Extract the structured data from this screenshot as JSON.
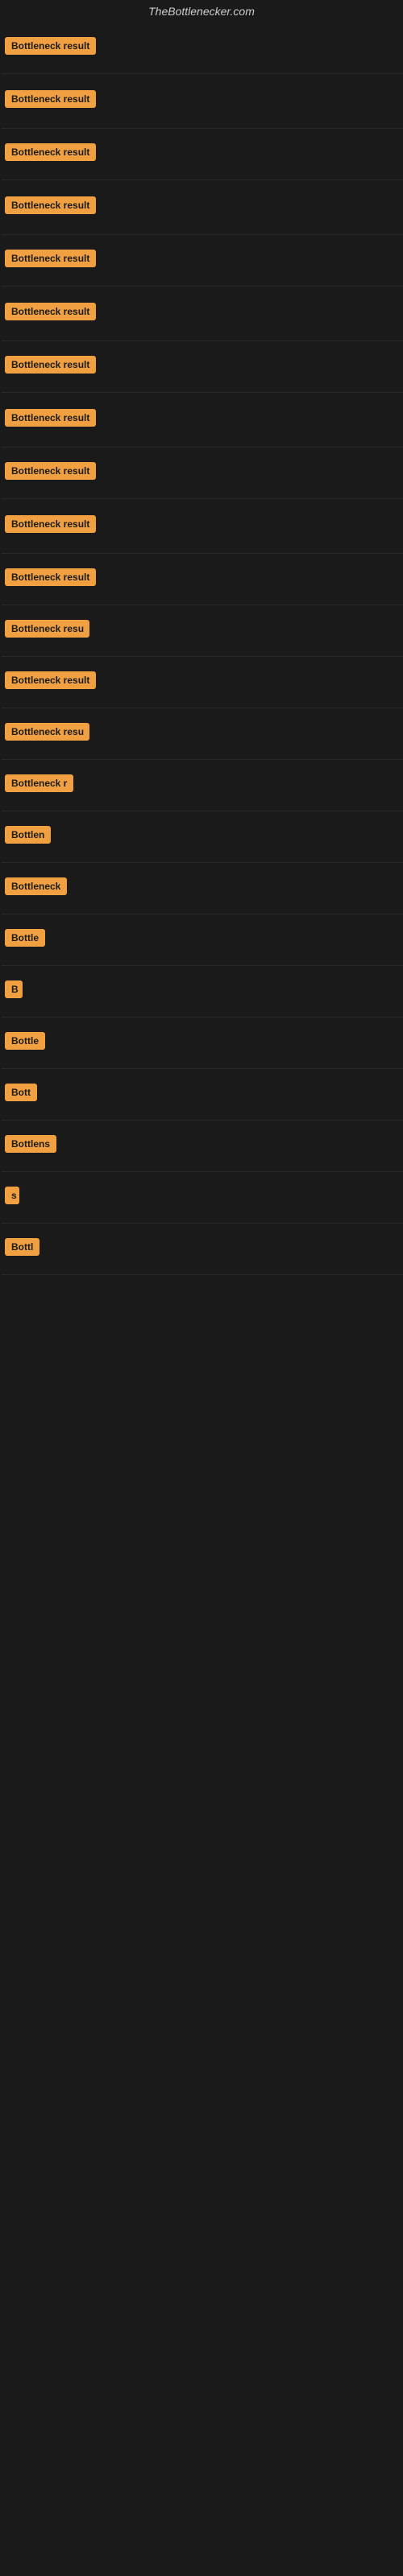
{
  "site": {
    "title": "TheBottlenecker.com"
  },
  "results": [
    {
      "id": 1,
      "label": "Bottleneck result",
      "badge_width": 115
    },
    {
      "id": 2,
      "label": "Bottleneck result",
      "badge_width": 115
    },
    {
      "id": 3,
      "label": "Bottleneck result",
      "badge_width": 115
    },
    {
      "id": 4,
      "label": "Bottleneck result",
      "badge_width": 115
    },
    {
      "id": 5,
      "label": "Bottleneck result",
      "badge_width": 115
    },
    {
      "id": 6,
      "label": "Bottleneck result",
      "badge_width": 115
    },
    {
      "id": 7,
      "label": "Bottleneck result",
      "badge_width": 115
    },
    {
      "id": 8,
      "label": "Bottleneck result",
      "badge_width": 115
    },
    {
      "id": 9,
      "label": "Bottleneck result",
      "badge_width": 115
    },
    {
      "id": 10,
      "label": "Bottleneck result",
      "badge_width": 115
    },
    {
      "id": 11,
      "label": "Bottleneck result",
      "badge_width": 115
    },
    {
      "id": 12,
      "label": "Bottleneck resu",
      "badge_width": 105
    },
    {
      "id": 13,
      "label": "Bottleneck result",
      "badge_width": 115
    },
    {
      "id": 14,
      "label": "Bottleneck resu",
      "badge_width": 105
    },
    {
      "id": 15,
      "label": "Bottleneck r",
      "badge_width": 88
    },
    {
      "id": 16,
      "label": "Bottlen",
      "badge_width": 68
    },
    {
      "id": 17,
      "label": "Bottleneck",
      "badge_width": 78
    },
    {
      "id": 18,
      "label": "Bottle",
      "badge_width": 58
    },
    {
      "id": 19,
      "label": "B",
      "badge_width": 22
    },
    {
      "id": 20,
      "label": "Bottle",
      "badge_width": 58
    },
    {
      "id": 21,
      "label": "Bott",
      "badge_width": 44
    },
    {
      "id": 22,
      "label": "Bottlens",
      "badge_width": 66
    },
    {
      "id": 23,
      "label": "s",
      "badge_width": 18
    },
    {
      "id": 24,
      "label": "Bottl",
      "badge_width": 52
    }
  ],
  "colors": {
    "badge_bg": "#f0a040",
    "background": "#1a1a1a",
    "title_color": "#cccccc"
  }
}
